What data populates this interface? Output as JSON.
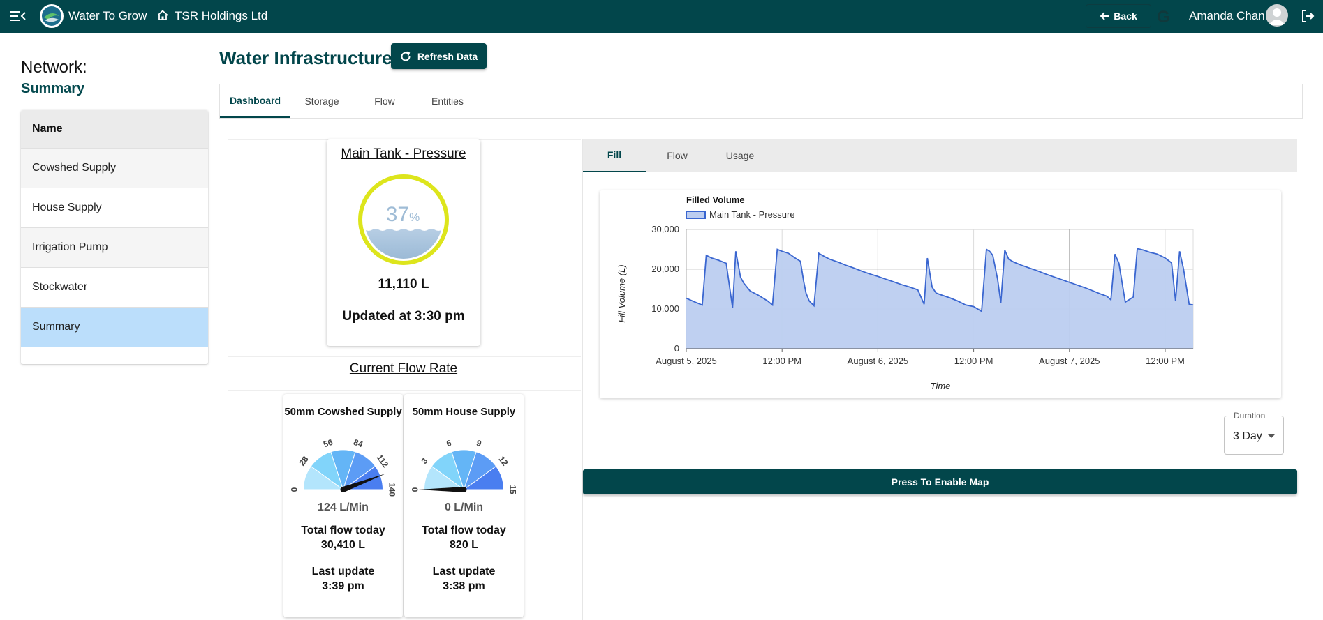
{
  "topbar": {
    "app_name": "Water To Grow",
    "org_name": "TSR Holdings Ltd",
    "back_label": "Back",
    "google_glyph": "G",
    "user_name": "Amanda Chan",
    "icons": [
      "menu-collapse-icon",
      "app-logo",
      "home-icon",
      "arrow-left-icon",
      "google-icon",
      "avatar-icon",
      "logout-icon"
    ]
  },
  "sidebar": {
    "title": "Network:",
    "subtitle": "Summary",
    "header": "Name",
    "items": [
      {
        "label": "Cowshed Supply"
      },
      {
        "label": "House Supply"
      },
      {
        "label": "Irrigation Pump"
      },
      {
        "label": "Stockwater"
      },
      {
        "label": "Summary"
      }
    ],
    "selected": "Summary"
  },
  "main": {
    "title": "Water Infrastructure",
    "refresh_label": "Refresh Data",
    "tabs": [
      {
        "label": "Dashboard"
      },
      {
        "label": "Storage"
      },
      {
        "label": "Flow"
      },
      {
        "label": "Entities"
      }
    ],
    "active_tab": "Dashboard"
  },
  "tank": {
    "name": "Main Tank - Pressure",
    "percent": "37",
    "percent_unit": "%",
    "fill_fraction": 0.37,
    "volume": "11,110 L",
    "updated": "Updated at 3:30 pm"
  },
  "flow_section": {
    "title": "Current Flow Rate",
    "cards": [
      {
        "name": "50mm Cowshed Supply",
        "ticks": [
          "0",
          "28",
          "56",
          "84",
          "112",
          "140"
        ],
        "max": 140,
        "value": 124,
        "rate": "124 L/Min",
        "total_label": "Total flow today",
        "total_value": "30,410 L",
        "last_label": "Last update",
        "last_value": "3:39 pm"
      },
      {
        "name": "50mm House Supply",
        "ticks": [
          "0",
          "3",
          "6",
          "9",
          "12",
          "15"
        ],
        "max": 15,
        "value": 0,
        "rate": "0 L/Min",
        "total_label": "Total flow today",
        "total_value": "820 L",
        "last_label": "Last update",
        "last_value": "3:38 pm"
      }
    ]
  },
  "right": {
    "tabs": [
      {
        "label": "Fill"
      },
      {
        "label": "Flow"
      },
      {
        "label": "Usage"
      }
    ],
    "active_tab": "Fill",
    "duration_label": "Duration",
    "duration_value": "3 Day",
    "map_button": "Press To Enable Map"
  },
  "chart_data": {
    "type": "area",
    "title": "Filled Volume",
    "xlabel": "Time",
    "ylabel": "Fill Volume (L)",
    "ylim": [
      0,
      30000
    ],
    "yticks": [
      0,
      10000,
      20000,
      30000
    ],
    "ytick_labels": [
      "0",
      "10,000",
      "20,000",
      "30,000"
    ],
    "xlim": [
      0,
      63.5
    ],
    "xticks": [
      0,
      12,
      24,
      36,
      48,
      60
    ],
    "xtick_labels": [
      "August 5, 2025",
      "12:00 PM",
      "August 6, 2025",
      "12:00 PM",
      "August 7, 2025",
      "12:00 PM"
    ],
    "legend_position": "top-left",
    "grid": true,
    "series": [
      {
        "name": "Main Tank - Pressure",
        "color": "#3a66d0",
        "fill": "#bccdf0",
        "x": [
          0,
          1.0,
          2.0,
          2.5,
          3.2,
          4.0,
          5.0,
          5.8,
          6.2,
          6.8,
          7.2,
          8.0,
          9.0,
          10.2,
          10.8,
          11.4,
          12.0,
          12.8,
          13.5,
          14.3,
          14.7,
          15.0,
          15.4,
          16.0,
          16.6,
          17.3,
          18.0,
          19.0,
          20.0,
          21.0,
          22.0,
          23.0,
          24.0,
          25.0,
          26.0,
          27.0,
          28.0,
          29.0,
          29.8,
          30.2,
          30.8,
          31.3,
          32.0,
          33.0,
          34.0,
          35.0,
          36.0,
          37.0,
          37.6,
          38.0,
          38.4,
          39.0,
          39.4,
          39.9,
          40.4,
          41.0,
          42.0,
          43.0,
          44.0,
          45.0,
          46.0,
          47.0,
          48.0,
          49.0,
          50.0,
          51.0,
          52.0,
          52.7,
          53.2,
          53.7,
          54.2,
          55.0,
          56.0,
          56.5,
          57.3,
          58.0,
          59.0,
          60.0,
          60.8,
          61.3,
          61.8,
          62.3,
          63.0,
          63.5
        ],
        "y": [
          12700,
          11800,
          11000,
          23500,
          22800,
          22300,
          21500,
          10300,
          24500,
          18000,
          16500,
          14500,
          13500,
          12000,
          11000,
          25000,
          24500,
          24000,
          23000,
          22000,
          17000,
          14000,
          12000,
          10800,
          24000,
          23200,
          22500,
          21800,
          21000,
          20300,
          19500,
          18800,
          18200,
          17500,
          16800,
          16100,
          15500,
          14800,
          11200,
          22800,
          15500,
          14000,
          13500,
          12800,
          12000,
          11000,
          10600,
          9400,
          25000,
          24500,
          23500,
          17500,
          11500,
          24800,
          22500,
          21800,
          21000,
          20300,
          19600,
          18800,
          18100,
          17400,
          16700,
          16000,
          15300,
          14500,
          13700,
          13200,
          12300,
          23800,
          21500,
          11700,
          13000,
          25200,
          24800,
          24300,
          23800,
          22800,
          21600,
          12000,
          24500,
          20000,
          11200,
          11000
        ]
      }
    ]
  }
}
